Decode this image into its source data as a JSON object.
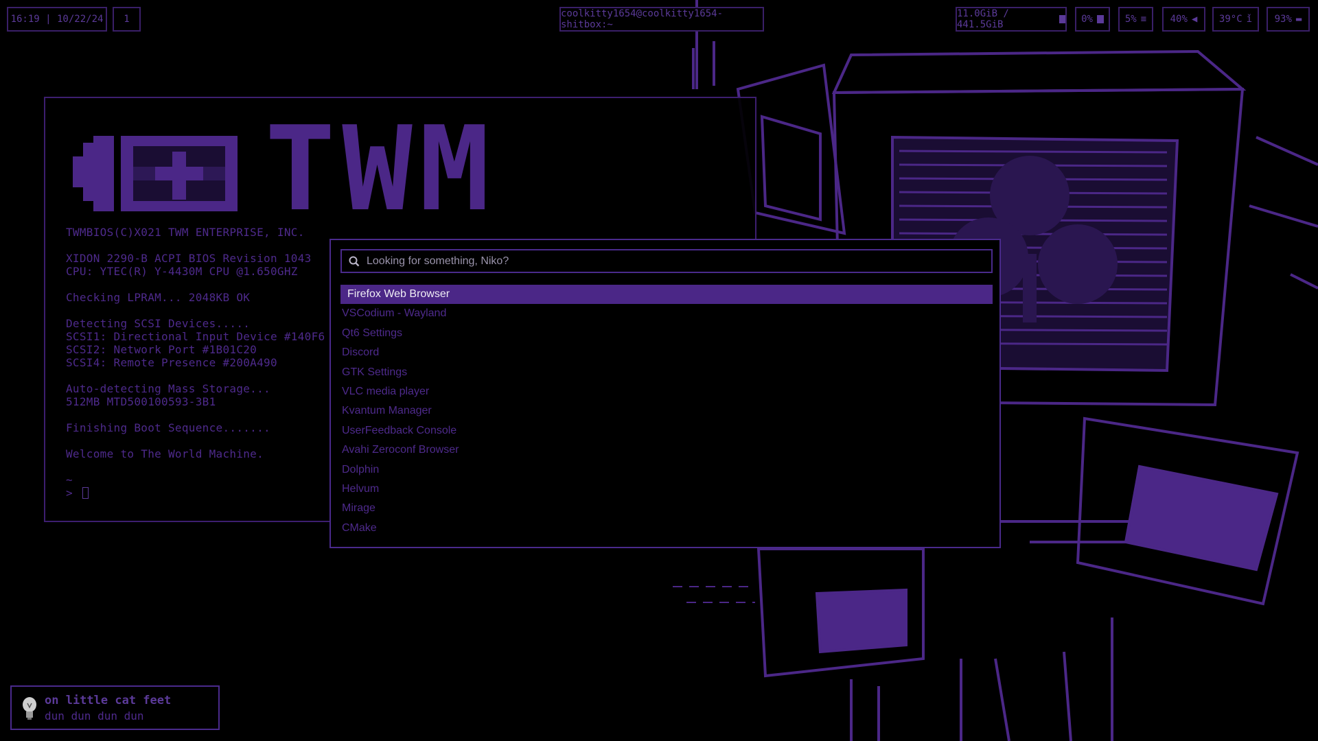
{
  "topbar": {
    "clock": "16:19 | 10/22/24",
    "workspace": "1",
    "window_title": "coolkitty1654@coolkitty1654-shitbox:~",
    "memory": "11.0GiB / 441.5GiB",
    "cpu": "0%",
    "disk": "5%",
    "volume": "40%",
    "temperature": "39°C",
    "battery": "93%"
  },
  "terminal": {
    "logo_text": "TWM",
    "lines": [
      "TWMBIOS(C)X021 TWM ENTERPRISE, INC.",
      "",
      "XIDON 2290-B ACPI BIOS Revision 1043",
      "CPU: YTEC(R) Y-4430M CPU @1.650GHZ",
      "",
      "Checking LPRAM... 2048KB OK",
      "",
      "Detecting SCSI Devices.....",
      "SCSI1: Directional Input Device #140F6",
      "SCSI2: Network Port #1B01C20",
      "SCSI4: Remote Presence #200A490",
      "",
      "Auto-detecting Mass Storage...",
      "512MB MTD500100593-3B1",
      "",
      "Finishing Boot Sequence.......",
      "",
      "Welcome to The World Machine.",
      "",
      "~",
      ">"
    ]
  },
  "launcher": {
    "search_placeholder": "Looking for something, Niko?",
    "apps": [
      "Firefox Web Browser",
      "VSCodium - Wayland",
      "Qt6 Settings",
      "Discord",
      "GTK Settings",
      "VLC media player",
      "Kvantum Manager",
      "UserFeedback Console",
      "Avahi Zeroconf Browser",
      "Dolphin",
      "Helvum",
      "Mirage",
      "CMake"
    ],
    "selected_index": 0
  },
  "notification": {
    "title": "on little cat feet",
    "body": "dun dun dun dun"
  },
  "colors": {
    "accent": "#4b2787",
    "text_dim": "#4e2a8c",
    "background": "#000000"
  }
}
